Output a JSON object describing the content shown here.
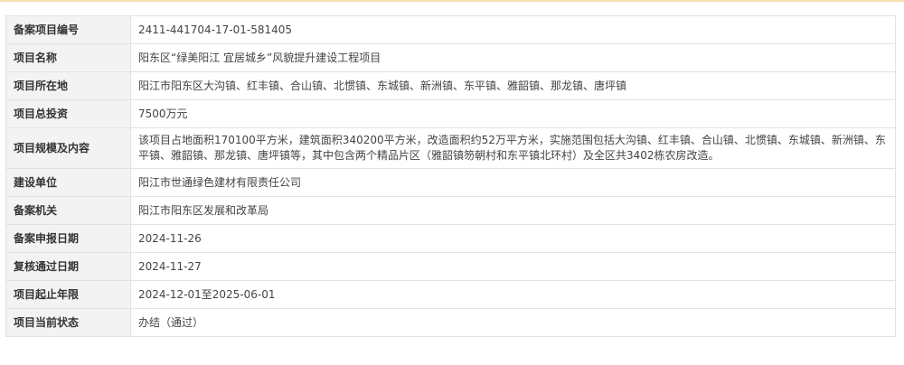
{
  "rows": [
    {
      "label": "备案项目编号",
      "value": "2411-441704-17-01-581405"
    },
    {
      "label": "项目名称",
      "value": "阳东区“绿美阳江 宜居城乡”风貌提升建设工程项目"
    },
    {
      "label": "项目所在地",
      "value": "阳江市阳东区大沟镇、红丰镇、合山镇、北惯镇、东城镇、新洲镇、东平镇、雅韶镇、那龙镇、唐坪镇"
    },
    {
      "label": "项目总投资",
      "value": "7500万元"
    },
    {
      "label": "项目规模及内容",
      "value": "该项目占地面积170100平方米，建筑面积340200平方米，改造面积约52万平方米，实施范围包括大沟镇、红丰镇、合山镇、北惯镇、东城镇、新洲镇、东平镇、雅韶镇、那龙镇、唐坪镇等，其中包含两个精品片区（雅韶镇笏朝村和东平镇北环村）及全区共3402栋农房改造。"
    },
    {
      "label": "建设单位",
      "value": "阳江市世通绿色建材有限责任公司"
    },
    {
      "label": "备案机关",
      "value": "阳江市阳东区发展和改革局"
    },
    {
      "label": "备案申报日期",
      "value": "2024-11-26"
    },
    {
      "label": "复核通过日期",
      "value": "2024-11-27"
    },
    {
      "label": "项目起止年限",
      "value": "2024-12-01至2025-06-01"
    },
    {
      "label": "项目当前状态",
      "value": "办结（通过）"
    }
  ]
}
